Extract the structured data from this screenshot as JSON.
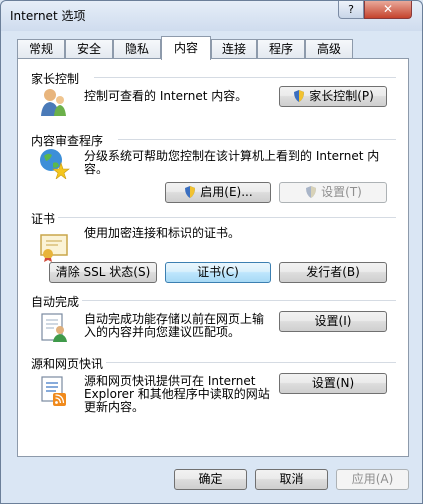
{
  "window": {
    "title": "Internet 选项",
    "help": "?",
    "close": "✕"
  },
  "tabs": [
    "常规",
    "安全",
    "隐私",
    "内容",
    "连接",
    "程序",
    "高级"
  ],
  "parental": {
    "heading": "家长控制",
    "desc": "控制可查看的 Internet 内容。",
    "button": "家长控制(P)"
  },
  "advisor": {
    "heading": "内容审查程序",
    "desc_line1": "分级系统可帮助您控制在该计算机上看到的 Internet 内",
    "desc_line2": "容。",
    "enable": "启用(E)...",
    "settings": "设置(T)"
  },
  "certs": {
    "heading": "证书",
    "desc": "使用加密连接和标识的证书。",
    "clear_ssl": "清除 SSL 状态(S)",
    "certificates": "证书(C)",
    "publishers": "发行者(B)"
  },
  "autocomplete": {
    "heading": "自动完成",
    "desc_line1": "自动完成功能存储以前在网页上输",
    "desc_line2": "入的内容并向您建议匹配项。",
    "settings": "设置(I)"
  },
  "feeds": {
    "heading": "源和网页快讯",
    "desc_line1": "源和网页快讯提供可在 Internet",
    "desc_line2": "Explorer 和其他程序中读取的网站",
    "desc_line3": "更新内容。",
    "settings": "设置(N)"
  },
  "footer": {
    "ok": "确定",
    "cancel": "取消",
    "apply": "应用(A)"
  },
  "colors": {
    "accent": "#3c7fb1",
    "window_bg": "#dae6f4",
    "panel_bg": "#ffffff"
  }
}
